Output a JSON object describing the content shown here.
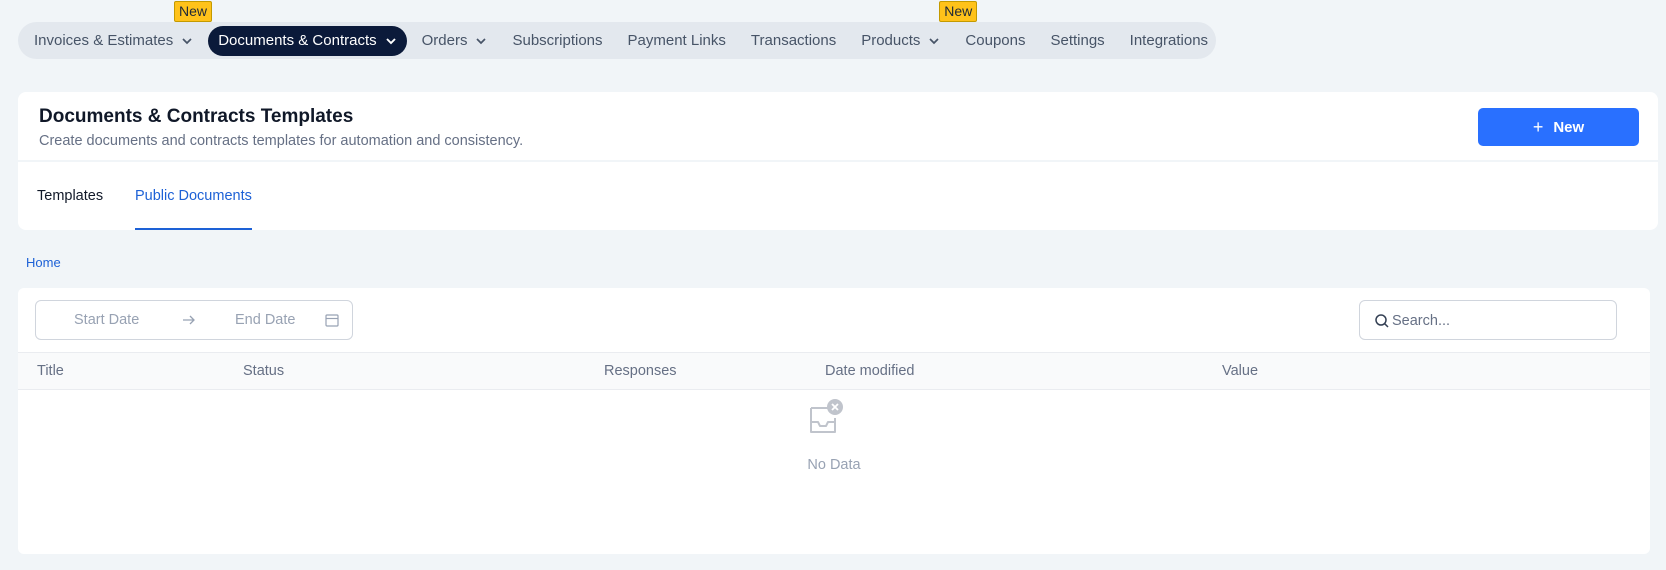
{
  "topnav": {
    "items": [
      {
        "label": "Invoices & Estimates",
        "dropdown": true
      },
      {
        "label": "Documents & Contracts",
        "dropdown": true,
        "active": true
      },
      {
        "label": "Orders",
        "dropdown": true
      },
      {
        "label": "Subscriptions"
      },
      {
        "label": "Payment Links"
      },
      {
        "label": "Transactions"
      },
      {
        "label": "Products",
        "dropdown": true
      },
      {
        "label": "Coupons"
      },
      {
        "label": "Settings"
      },
      {
        "label": "Integrations"
      }
    ],
    "badges": {
      "invoices_new": "New",
      "products_new": "New"
    }
  },
  "header": {
    "title": "Documents & Contracts Templates",
    "subtitle": "Create documents and contracts templates for automation and consistency.",
    "new_button": "New"
  },
  "tabs": [
    {
      "label": "Templates",
      "active": false
    },
    {
      "label": "Public Documents",
      "active": true
    }
  ],
  "breadcrumb": "Home",
  "filters": {
    "start_date_placeholder": "Start Date",
    "end_date_placeholder": "End Date",
    "search_placeholder": "Search..."
  },
  "table": {
    "columns": [
      "Title",
      "Status",
      "Responses",
      "Date modified",
      "Value"
    ],
    "empty_text": "No Data"
  },
  "colors": {
    "accent": "#2970ff",
    "nav_active": "#0b1a3a",
    "tab_active": "#1d61d6",
    "badge": "#ffc21a"
  }
}
